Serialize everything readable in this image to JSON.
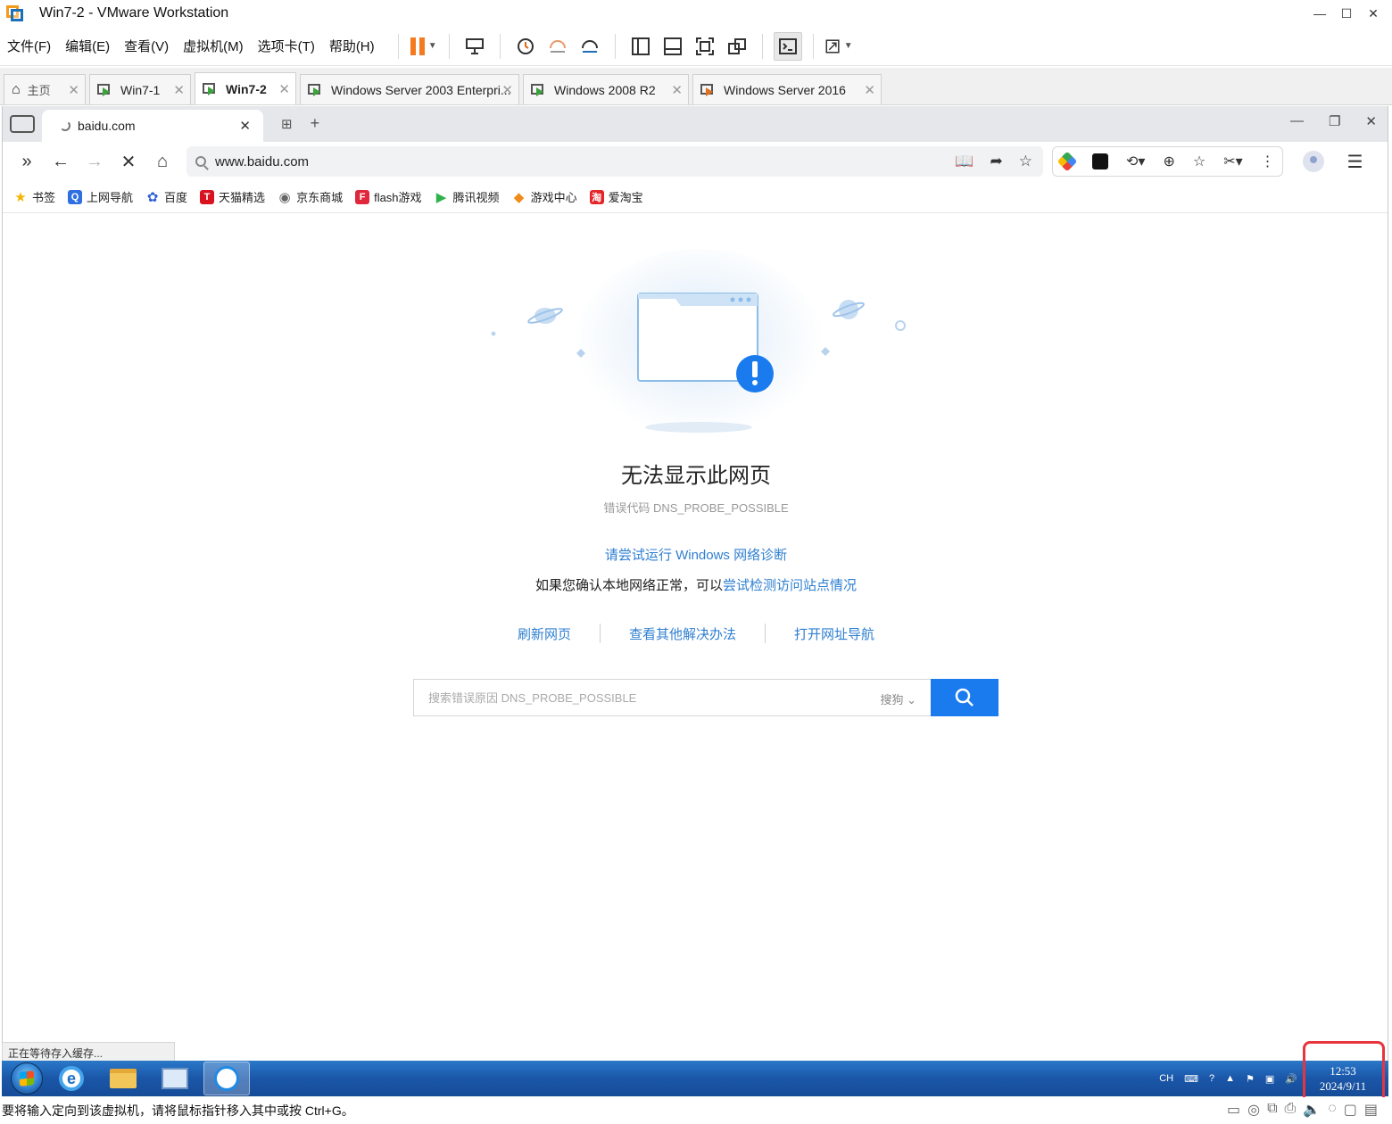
{
  "vmware": {
    "title": "Win7-2 - VMware Workstation",
    "menu": [
      "文件(F)",
      "编辑(E)",
      "查看(V)",
      "虚拟机(M)",
      "选项卡(T)",
      "帮助(H)"
    ],
    "tabs": [
      {
        "label": "主页",
        "active": false
      },
      {
        "label": "Win7-1",
        "active": false
      },
      {
        "label": "Win7-2",
        "active": true
      },
      {
        "label": "Windows Server 2003 Enterpri...",
        "active": false
      },
      {
        "label": "Windows 2008 R2",
        "active": false
      },
      {
        "label": "Windows Server 2016",
        "active": false
      }
    ],
    "status_text": "要将输入定向到该虚拟机，请将鼠标指针移入其中或按 Ctrl+G。"
  },
  "browser": {
    "tab_title": "baidu.com",
    "url": "www.baidu.com",
    "bookmarks": [
      {
        "label": "书签",
        "color": "#f5b400",
        "glyph": "★"
      },
      {
        "label": "上网导航",
        "color": "#2f6fe0",
        "glyph": "Q"
      },
      {
        "label": "百度",
        "color": "#2f5fd6",
        "glyph": "✿"
      },
      {
        "label": "天猫精选",
        "color": "#d8131f",
        "glyph": "T"
      },
      {
        "label": "京东商城",
        "color": "#666666",
        "glyph": "◉"
      },
      {
        "label": "flash游戏",
        "color": "#e0283c",
        "glyph": "F"
      },
      {
        "label": "腾讯视频",
        "color": "#2fb24c",
        "glyph": "▶"
      },
      {
        "label": "游戏中心",
        "color": "#f08a1a",
        "glyph": "◆"
      },
      {
        "label": "爱淘宝",
        "color": "#e4262a",
        "glyph": "淘"
      }
    ]
  },
  "error_page": {
    "title": "无法显示此网页",
    "code": "错误代码 DNS_PROBE_POSSIBLE",
    "diagnose_link": "请尝试运行 Windows 网络诊断",
    "line2_prefix": "如果您确认本地网络正常，可以",
    "line2_link": "尝试检测访问站点情况",
    "actions": [
      "刷新网页",
      "查看其他解决办法",
      "打开网址导航"
    ],
    "search_placeholder": "搜索错误原因 DNS_PROBE_POSSIBLE",
    "search_engine": "搜狗"
  },
  "guest": {
    "status_text": "正在等待存入缓存...",
    "tray": {
      "lang": "CH"
    },
    "clock_time": "12:53",
    "clock_date": "2024/9/11"
  },
  "colors": {
    "link": "#2f7fd0",
    "search_button": "#1a7bee",
    "highlight": "#e8343e",
    "taskbar": "#1a56a8"
  }
}
